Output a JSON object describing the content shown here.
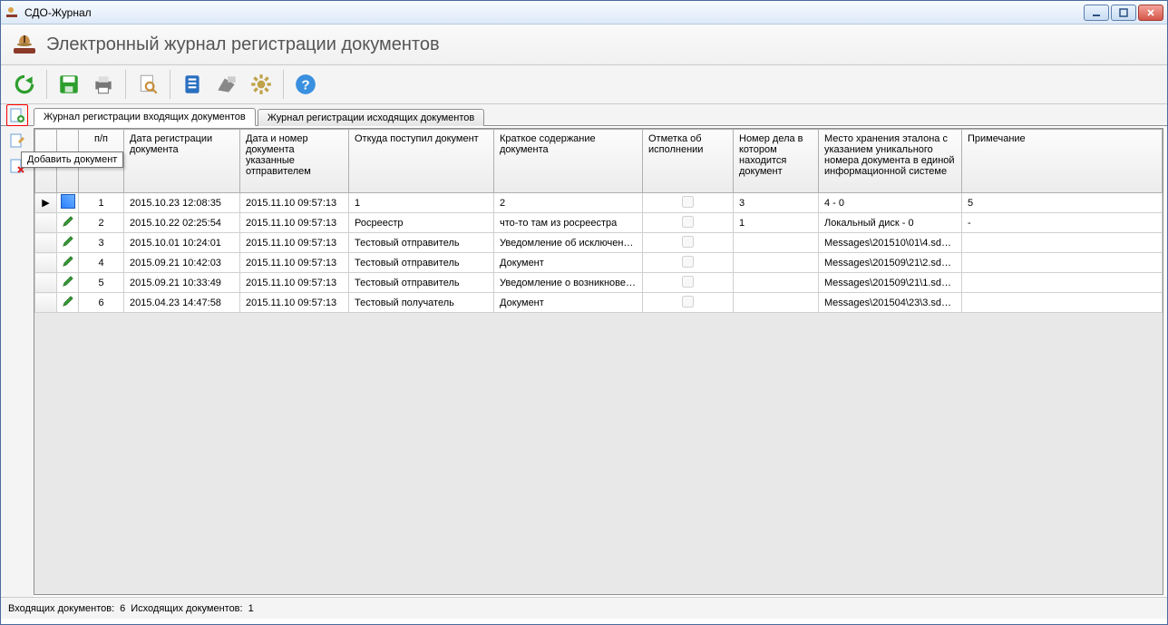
{
  "window": {
    "title": "СДО-Журнал"
  },
  "header": {
    "heading": "Электронный журнал регистрации документов"
  },
  "toolbar_icons": {
    "refresh": "refresh-icon",
    "save": "save-icon",
    "print": "print-icon",
    "search": "search-doc-icon",
    "journal": "journal-icon",
    "scan": "scan-icon",
    "settings": "gear-icon",
    "help": "help-icon"
  },
  "tabs": {
    "incoming": "Журнал регистрации входящих документов",
    "outgoing": "Журнал регистрации исходящих документов"
  },
  "side": {
    "add_doc_tooltip": "Добавить документ"
  },
  "columns": {
    "rownum": "п/п",
    "reg_date": "Дата регистрации документа",
    "sender_date": "Дата и номер документа указанные отправителем",
    "from": "Откуда поступил документ",
    "summary": "Краткое содержание документа",
    "exec_mark": "Отметка об исполнении",
    "case_num": "Номер дела в котором находится документ",
    "storage": "Место хранения эталона с указанием уникального номера документа в единой информационной системе",
    "note": "Примечание"
  },
  "rows": [
    {
      "n": "1",
      "reg": "2015.10.23 12:08:35",
      "sender": "2015.11.10 09:57:13",
      "from": "1",
      "summary": "2",
      "exec": false,
      "case": "3",
      "storage": "4 - 0",
      "note": "5",
      "active": true
    },
    {
      "n": "2",
      "reg": "2015.10.22 02:25:54",
      "sender": "2015.11.10 09:57:13",
      "from": "Росреестр",
      "summary": "что-то там из росреестра",
      "exec": false,
      "case": "1",
      "storage": "Локальный диск - 0",
      "note": "-",
      "active": false
    },
    {
      "n": "3",
      "reg": "2015.10.01 10:24:01",
      "sender": "2015.11.10 09:57:13",
      "from": "Тестовый отправитель",
      "summary": "Уведомление об исключени...",
      "exec": false,
      "case": "",
      "storage": "Messages\\201510\\01\\4.sdo - ...",
      "note": "",
      "active": false
    },
    {
      "n": "4",
      "reg": "2015.09.21 10:42:03",
      "sender": "2015.11.10 09:57:13",
      "from": "Тестовый отправитель",
      "summary": "Документ",
      "exec": false,
      "case": "",
      "storage": "Messages\\201509\\21\\2.sdo - ...",
      "note": "",
      "active": false
    },
    {
      "n": "5",
      "reg": "2015.09.21 10:33:49",
      "sender": "2015.11.10 09:57:13",
      "from": "Тестовый отправитель",
      "summary": "Уведомление о возникновен...",
      "exec": false,
      "case": "",
      "storage": "Messages\\201509\\21\\1.sdo - ...",
      "note": "",
      "active": false
    },
    {
      "n": "6",
      "reg": "2015.04.23 14:47:58",
      "sender": "2015.11.10 09:57:13",
      "from": "Тестовый получатель",
      "summary": "Документ",
      "exec": false,
      "case": "",
      "storage": "Messages\\201504\\23\\3.sdo - ...",
      "note": "",
      "active": false
    }
  ],
  "status": {
    "incoming_label": "Входящих документов:",
    "incoming_count": "6",
    "outgoing_label": "Исходящих документов:",
    "outgoing_count": "1"
  }
}
